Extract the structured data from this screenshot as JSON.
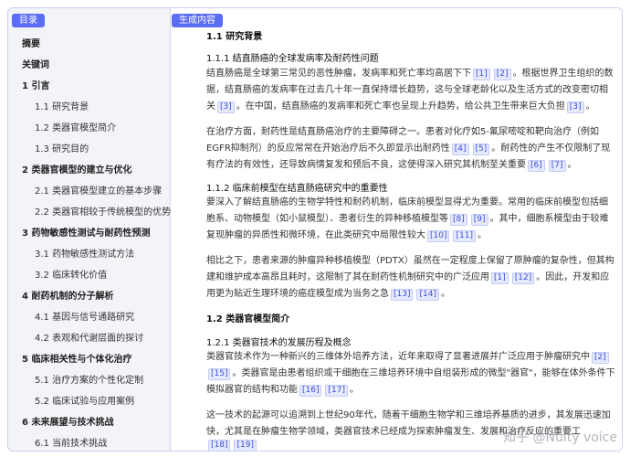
{
  "sidebar": {
    "tag": "目录",
    "items": [
      {
        "label": "摘要",
        "level": 1
      },
      {
        "label": "关键词",
        "level": 1
      },
      {
        "label": "1 引言",
        "level": 1
      },
      {
        "label": "1.1 研究背景",
        "level": 2
      },
      {
        "label": "1.2 类器官模型简介",
        "level": 2
      },
      {
        "label": "1.3 研究目的",
        "level": 2
      },
      {
        "label": "2 类器官模型的建立与优化",
        "level": 1
      },
      {
        "label": "2.1 类器官模型建立的基本步骤",
        "level": 2
      },
      {
        "label": "2.2 类器官相较于传统模型的优势",
        "level": 2
      },
      {
        "label": "3 药物敏感性测试与耐药性预测",
        "level": 1
      },
      {
        "label": "3.1 药物敏感性测试方法",
        "level": 2
      },
      {
        "label": "3.2 临床转化价值",
        "level": 2
      },
      {
        "label": "4 耐药机制的分子解析",
        "level": 1
      },
      {
        "label": "4.1 基因与信号通路研究",
        "level": 2
      },
      {
        "label": "4.2 表观和代谢层面的探讨",
        "level": 2
      },
      {
        "label": "5 临床相关性与个体化治疗",
        "level": 1
      },
      {
        "label": "5.1 治疗方案的个性化定制",
        "level": 2
      },
      {
        "label": "5.2 临床试验与应用案例",
        "level": 2
      },
      {
        "label": "6 未来展望与技术挑战",
        "level": 1
      },
      {
        "label": "6.1 当前技术挑战",
        "level": 2
      }
    ]
  },
  "main": {
    "tag": "生成内容",
    "lines": [
      {
        "type": "h2",
        "parts": [
          {
            "t": "1.1 研究背景"
          }
        ]
      },
      {
        "type": "h3",
        "parts": [
          {
            "t": "1.1.1 结直肠癌的全球发病率及耐药性问题"
          }
        ]
      },
      {
        "type": "p",
        "parts": [
          {
            "t": "结直肠癌是全球第三常见的恶性肿瘤，发病率和死亡率均高居下下"
          },
          {
            "c": "[1]"
          },
          {
            "c": "[2]"
          },
          {
            "t": "。根据世界卫生组织的数"
          }
        ]
      },
      {
        "type": "p",
        "parts": [
          {
            "t": "据，结直肠癌的发病率在过去几十年一直保持增长趋势，这与全球老龄化以及生活方式的改变密切相"
          }
        ]
      },
      {
        "type": "p",
        "parts": [
          {
            "t": "关"
          },
          {
            "c": "[3]"
          },
          {
            "t": "。在中国，结直肠癌的发病率和死亡率也呈现上升趋势，给公共卫生带来巨大负担"
          },
          {
            "c": "[3]"
          },
          {
            "t": "。"
          }
        ]
      },
      {
        "type": "p",
        "parts": [
          {
            "t": "在治疗方面，耐药性是结直肠癌治疗的主要障碍之一。患者对化疗如5-氟尿嘧啶和靶向治疗（例如"
          }
        ]
      },
      {
        "type": "p",
        "parts": [
          {
            "t": "EGFR抑制剂）的反应常常在开始治疗后不久即显示出耐药性"
          },
          {
            "c": "[4]"
          },
          {
            "c": "[5]"
          },
          {
            "t": "。耐药性的产生不仅限制了现"
          }
        ]
      },
      {
        "type": "p",
        "parts": [
          {
            "t": "有疗法的有效性，还导致病情复发和预后不良，这使得深入研究其机制至关重要"
          },
          {
            "c": "[6]"
          },
          {
            "c": "[7]"
          },
          {
            "t": "。"
          }
        ]
      },
      {
        "type": "h3",
        "parts": [
          {
            "t": "1.1.2 临床前模型在结直肠癌研究中的重要性"
          }
        ]
      },
      {
        "type": "p",
        "parts": [
          {
            "t": "要深入了解结直肠癌的生物学特性和耐药机制，临床前模型显得尤为重要。常用的临床前模型包括细"
          }
        ]
      },
      {
        "type": "p",
        "parts": [
          {
            "t": "胞系、动物模型（如小鼠模型）、患者衍生的异种移植模型等"
          },
          {
            "c": "[8]"
          },
          {
            "c": "[9]"
          },
          {
            "t": "。其中，细胞系模型由于较难"
          }
        ]
      },
      {
        "type": "p",
        "parts": [
          {
            "t": "复现肿瘤的异质性和微环境，在此类研究中局限性较大"
          },
          {
            "c": "[10]"
          },
          {
            "c": "[11]"
          },
          {
            "t": "。"
          }
        ]
      },
      {
        "type": "p",
        "parts": [
          {
            "t": "相比之下，患者来源的肿瘤异种移植模型（PDTX）虽然在一定程度上保留了原肿瘤的复杂性，但其构"
          }
        ]
      },
      {
        "type": "p",
        "parts": [
          {
            "t": "建和维护成本高昂且耗时，这限制了其在耐药性机制研究中的广泛应用"
          },
          {
            "c": "[1]"
          },
          {
            "c": "[12]"
          },
          {
            "t": "。因此，开发和应"
          }
        ]
      },
      {
        "type": "p",
        "parts": [
          {
            "t": "用更为贴近生理环境的癌症模型成为当务之急"
          },
          {
            "c": "[13]"
          },
          {
            "c": "[14]"
          },
          {
            "t": "。"
          }
        ]
      },
      {
        "type": "h2",
        "parts": [
          {
            "t": "1.2 类器官模型简介"
          }
        ]
      },
      {
        "type": "h3",
        "parts": [
          {
            "t": "1.2.1 类器官技术的发展历程及概念"
          }
        ]
      },
      {
        "type": "p",
        "parts": [
          {
            "t": "类器官技术作为一种新兴的三维体外培养方法，近年来取得了显著进展并广泛应用于肿瘤研究中"
          },
          {
            "c": "[2]"
          }
        ]
      },
      {
        "type": "p",
        "parts": [
          {
            "c": "[15]"
          },
          {
            "t": "。类器官是由患者组织或干细胞在三维培养环境中自组装形成的微型\"器官\"，能够在体外条件下"
          }
        ]
      },
      {
        "type": "p",
        "parts": [
          {
            "t": "模拟器官的结构和功能"
          },
          {
            "c": "[16]"
          },
          {
            "c": "[17]"
          },
          {
            "t": "。"
          }
        ]
      },
      {
        "type": "p",
        "parts": [
          {
            "t": "这一技术的起源可以追溯到上世纪90年代，随着干细胞生物学和三维培养基质的进步，其发展迅速加"
          }
        ]
      },
      {
        "type": "p",
        "parts": [
          {
            "t": "快，尤其是在肿瘤生物学领域，类器官技术已经成为探索肿瘤发生、发展和治疗反应的重要工"
          }
        ]
      },
      {
        "type": "p",
        "parts": [
          {
            "c": "[18]"
          },
          {
            "c": "[19]"
          }
        ]
      }
    ]
  },
  "watermark": "知乎 @Nulty voice"
}
